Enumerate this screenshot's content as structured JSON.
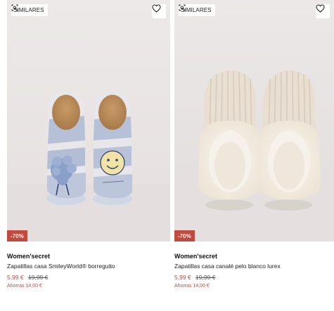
{
  "products": [
    {
      "similares_label": "SIMILARES",
      "discount_badge": "-70%",
      "brand": "Women'secret",
      "name": "Zapatillas casa SmileyWorld® borreguito",
      "price_now": "5,99 €",
      "price_old": "19,99 €",
      "saving": "Ahorras 14,00 €",
      "image": "blue-white-tie-dye-slippers-smiley-print"
    },
    {
      "similares_label": "SIMILARES",
      "discount_badge": "-70%",
      "brand": "Women'secret",
      "name": "Zapatillas casa canalé pelo blanco lurex",
      "price_now": "5,99 €",
      "price_old": "19,99 €",
      "saving": "Ahorras 14,00 €",
      "image": "cream-ribbed-slippers-faux-fur-cuff"
    }
  ],
  "icons": {
    "similares": "similar-search-icon",
    "favorite": "heart-outline-icon"
  },
  "colors": {
    "discount": "#c04a3e",
    "price_now": "#c04a3e"
  }
}
